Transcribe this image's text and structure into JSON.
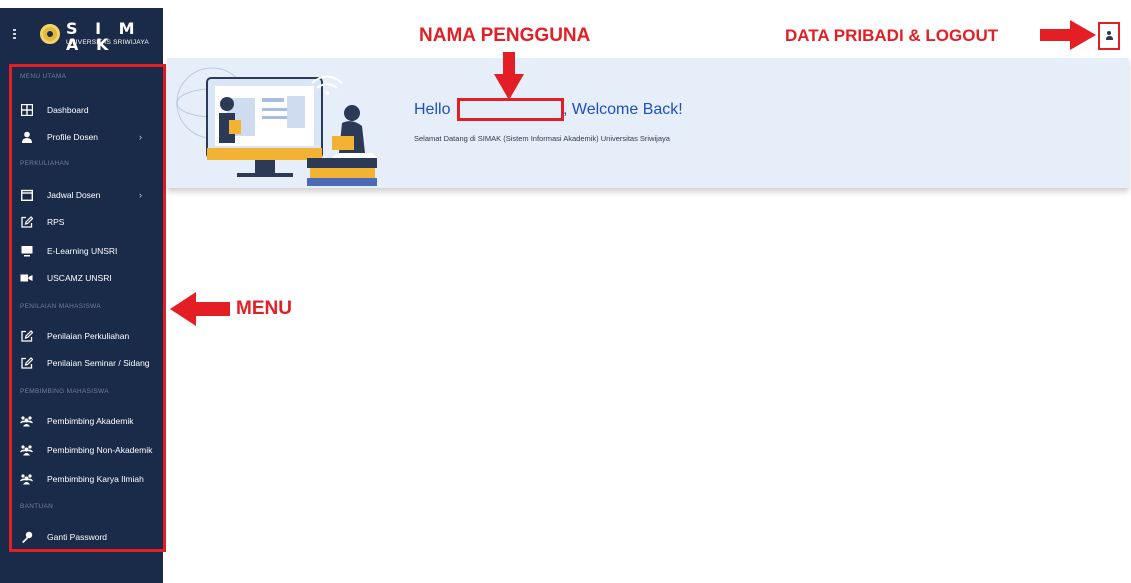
{
  "app": {
    "logo_text": "S I M A K",
    "logo_subtitle": "UNIVERSITAS SRIWIJAYA"
  },
  "sidebar": {
    "sections": [
      {
        "label": "MENU UTAMA"
      },
      {
        "label": "PERKULIAHAN"
      },
      {
        "label": "PENILAIAN MAHASISWA"
      },
      {
        "label": "PEMBIMBING MAHASISWA"
      },
      {
        "label": "BANTUAN"
      }
    ],
    "items": [
      {
        "label": "Dashboard",
        "icon": "grid-icon"
      },
      {
        "label": "Profile Dosen",
        "icon": "user-icon",
        "has_submenu": true
      },
      {
        "label": "Jadwal Dosen",
        "icon": "calendar-icon",
        "has_submenu": true
      },
      {
        "label": "RPS",
        "icon": "edit-icon"
      },
      {
        "label": "E-Learning UNSRI",
        "icon": "monitor-icon"
      },
      {
        "label": "USCAMZ UNSRI",
        "icon": "video-icon"
      },
      {
        "label": "Penilaian Perkuliahan",
        "icon": "edit-icon"
      },
      {
        "label": "Penilaian Seminar / Sidang",
        "icon": "edit-icon"
      },
      {
        "label": "Pembimbing Akademik",
        "icon": "users-icon"
      },
      {
        "label": "Pembimbing Non-Akademik",
        "icon": "users-icon"
      },
      {
        "label": "Pembimbing Karya Ilmiah",
        "icon": "users-icon"
      },
      {
        "label": "Ganti Password",
        "icon": "key-icon"
      }
    ],
    "submenu_chevron": "›"
  },
  "annotations": {
    "nama_pengguna": "NAMA PENGGUNA",
    "data_pribadi": "DATA PRIBADI & LOGOUT",
    "menu": "MENU",
    "accent_color": "#e41e25"
  },
  "banner": {
    "hello": "Hello",
    "welcome": ", Welcome Back!",
    "subtitle": "Selamat Datang di SIMAK (Sistem Informasi Akademik) Universitas Sriwijaya"
  },
  "colors": {
    "sidebar_bg": "#1a2b4a",
    "banner_bg": "#e6eef9",
    "greeting_blue": "#1f4fbf"
  }
}
